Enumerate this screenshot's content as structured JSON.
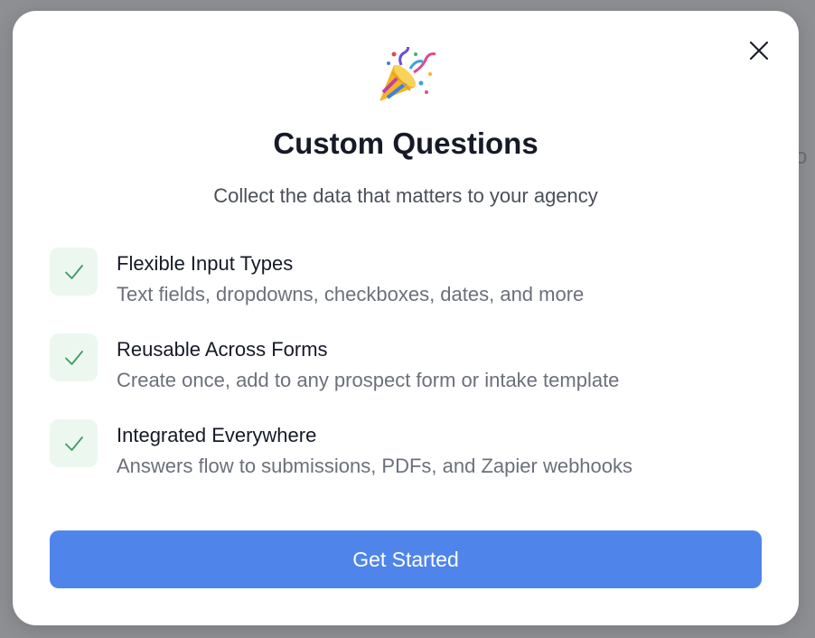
{
  "background": {
    "fragment_text": "tio"
  },
  "modal": {
    "icons": {
      "close": "close-icon",
      "hero": "party-popper-icon",
      "feature": "check-icon"
    },
    "title": "Custom Questions",
    "subtitle": "Collect the data that matters to your agency",
    "features": [
      {
        "title": "Flexible Input Types",
        "description": "Text fields, dropdowns, checkboxes, dates, and more"
      },
      {
        "title": "Reusable Across Forms",
        "description": "Create once, add to any prospect form or intake template"
      },
      {
        "title": "Integrated Everywhere",
        "description": "Answers flow to submissions, PDFs, and Zapier webhooks"
      }
    ],
    "cta_label": "Get Started"
  },
  "colors": {
    "overlay": "#8e8f93",
    "accent": "#4f85ea",
    "check": "#3f9b62",
    "check_bg": "#ecf8ef",
    "title_text": "#161a26",
    "muted_text": "#6b707a"
  }
}
